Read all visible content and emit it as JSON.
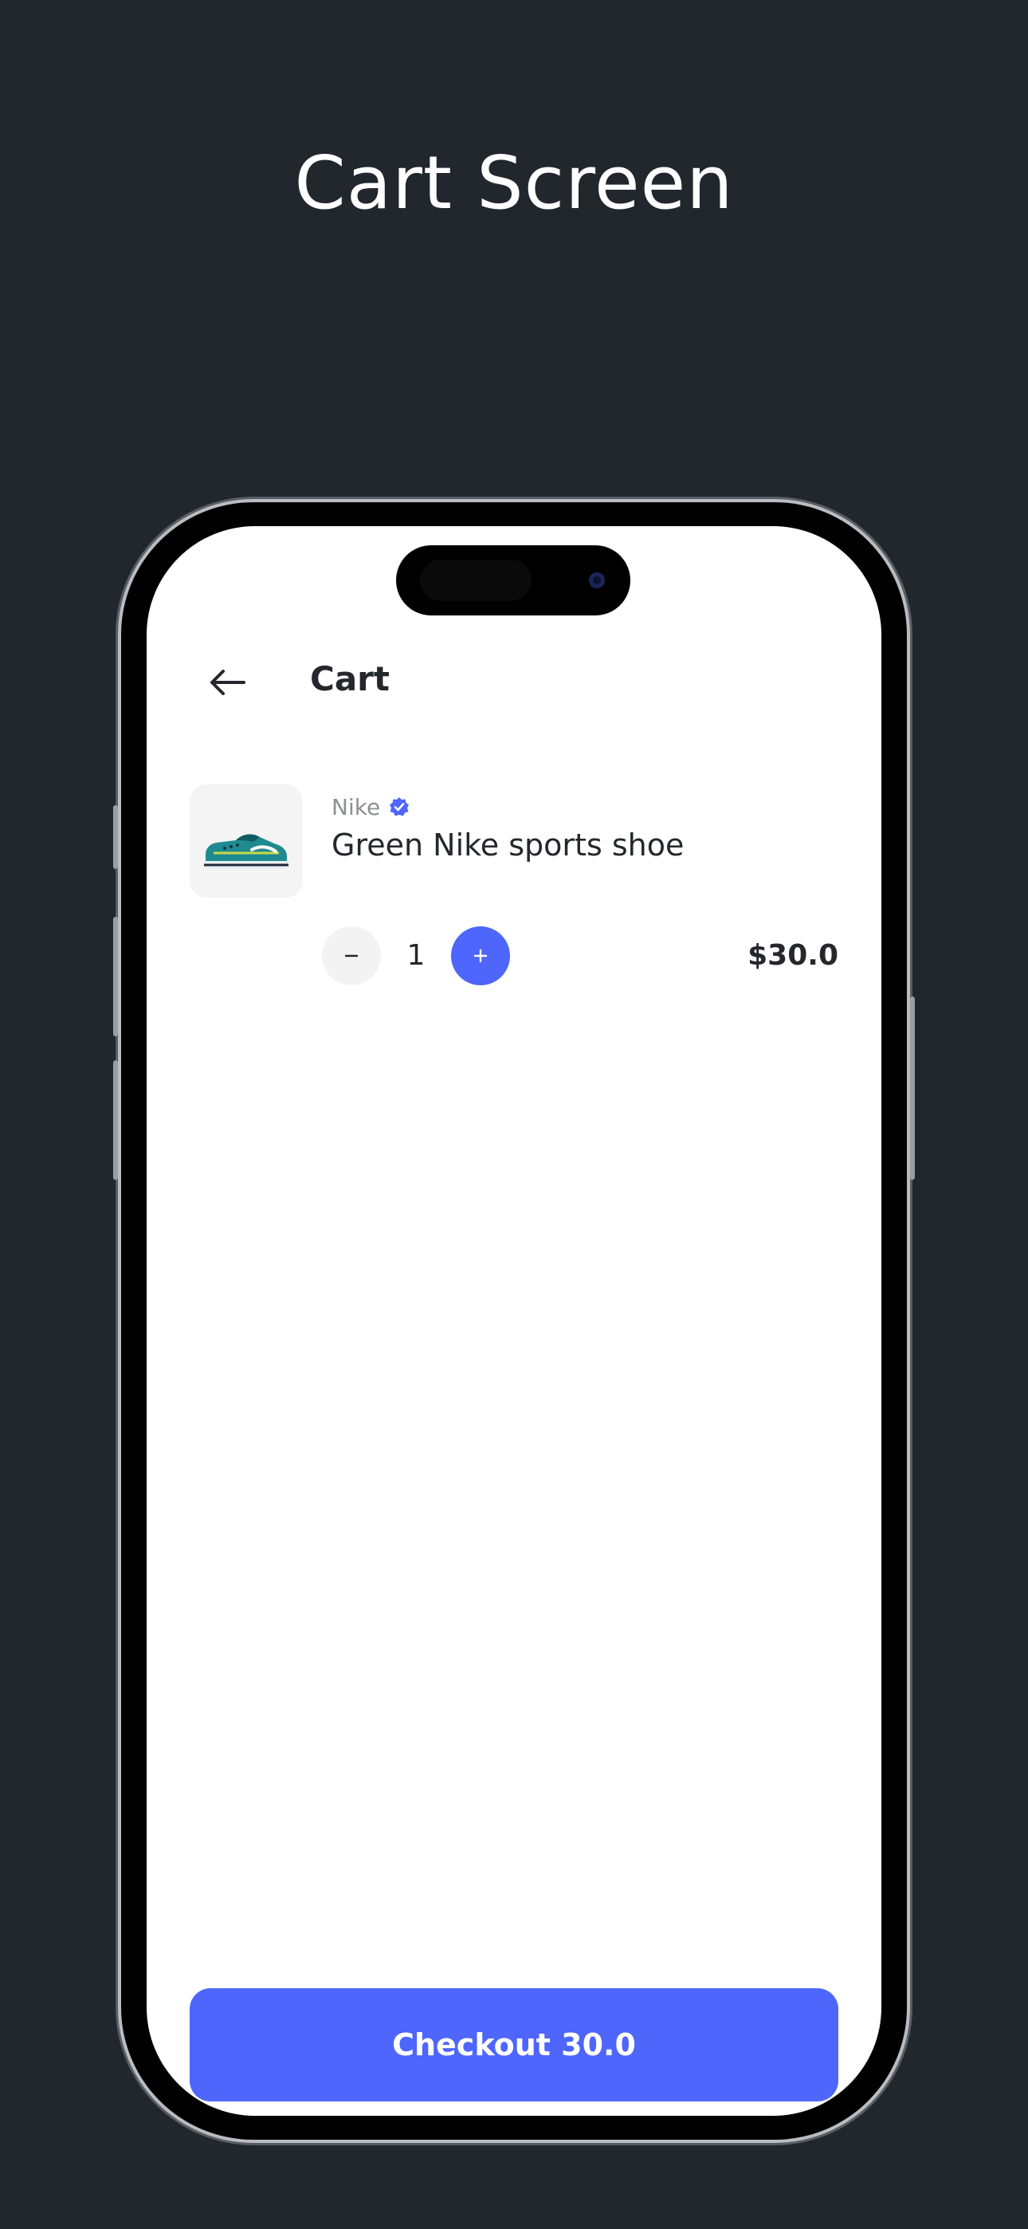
{
  "page": {
    "heading": "Cart Screen"
  },
  "app_bar": {
    "title": "Cart",
    "back_icon": "arrow-left-icon"
  },
  "cart": {
    "items": [
      {
        "brand": "Nike",
        "verified_icon": "verified-badge-icon",
        "name": "Green Nike sports shoe",
        "quantity": "1",
        "price": "$30.0",
        "image_icon": "sneaker-image"
      }
    ]
  },
  "checkout": {
    "label": "Checkout 30.0"
  },
  "colors": {
    "background": "#22262d",
    "accent": "#4e66fb",
    "screen": "#ffffff",
    "text": "#24272c",
    "muted_text": "#8d8f93"
  }
}
